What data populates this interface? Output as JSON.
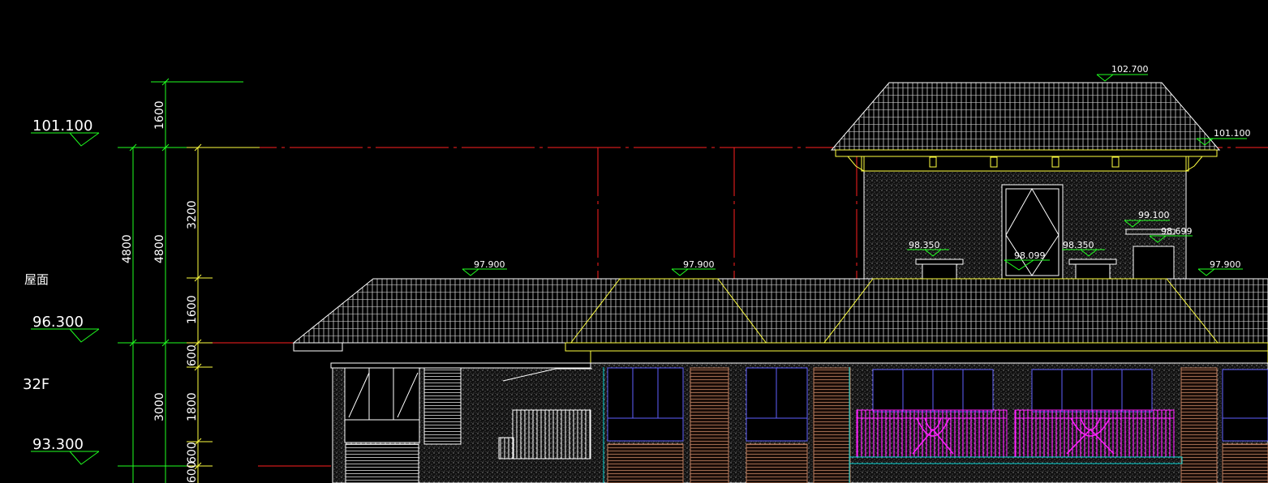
{
  "left_levels": [
    {
      "id": "lvl-101",
      "value": "101.100"
    },
    {
      "id": "lvl-96",
      "value": "96.300"
    },
    {
      "id": "lvl-93",
      "value": "93.300"
    }
  ],
  "left_labels": {
    "roof": "屋面",
    "floor": "32F"
  },
  "dimensions": {
    "d1600_top": "1600",
    "d4800_a": "4800",
    "d4800_b": "4800",
    "d3200": "3200",
    "d1600_mid": "1600",
    "d600_a": "600",
    "d3000": "3000",
    "d1800": "1800",
    "d600_b": "600",
    "d600_c": "600"
  },
  "elevation_marks": {
    "top_ridge": "102.700",
    "right_eave": "101.100",
    "parapet_a": "99.100",
    "parapet_b": "98.699",
    "cap_left": "98.350",
    "cap_mid": "98.099",
    "cap_right": "98.350",
    "roof_left": "97.900",
    "roof_mid": "97.900",
    "roof_right": "97.900"
  },
  "colors": {
    "background": "#000000",
    "grid_line": "#ff2020",
    "dimension": "#ffff40",
    "level_mark": "#20ff20",
    "building": "#ffffff",
    "window": "#6060ff",
    "railing": "#ff20ff",
    "cyan_line": "#00d0d0"
  }
}
